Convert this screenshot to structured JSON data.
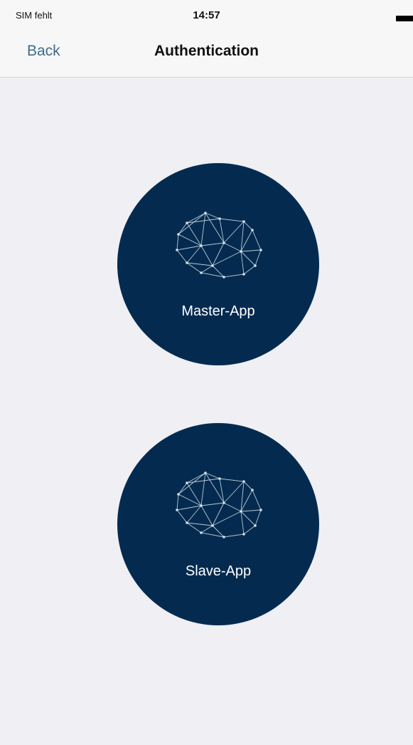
{
  "status_bar": {
    "carrier": "SIM fehlt",
    "time": "14:57"
  },
  "nav": {
    "back_label": "Back",
    "title": "Authentication"
  },
  "options": [
    {
      "label": "Master-App",
      "icon": "network-mesh-icon"
    },
    {
      "label": "Slave-App",
      "icon": "network-mesh-icon"
    }
  ],
  "colors": {
    "background": "#efeff4",
    "nav_background": "#f7f7f7",
    "circle_fill": "#042b4f",
    "back_link": "#3e6b8c",
    "label_text": "#ffffff"
  }
}
